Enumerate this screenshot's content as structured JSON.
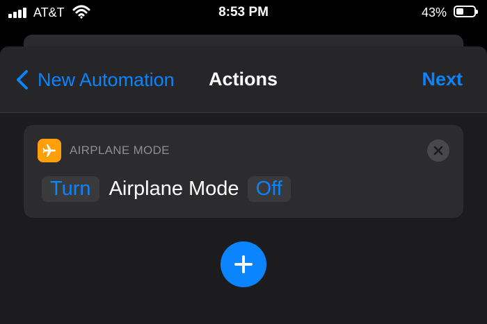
{
  "status_bar": {
    "carrier": "AT&T",
    "time": "8:53 PM",
    "battery": "43%",
    "battery_level": 0.43,
    "signal_bars": 4,
    "icons": [
      "signal-icon",
      "wifi-icon",
      "battery-icon"
    ]
  },
  "nav": {
    "back_label": "New Automation",
    "title": "Actions",
    "next_label": "Next"
  },
  "action": {
    "icon": "airplane-icon",
    "header": "AIRPLANE MODE",
    "verb": "Turn",
    "name": "Airplane Mode",
    "state": "Off"
  },
  "colors": {
    "accent": "#0a84ff",
    "airplane_icon_bg": "#ff9f0a",
    "card_bg": "#2c2c2e",
    "sheet_bg": "#1c1c1e"
  }
}
